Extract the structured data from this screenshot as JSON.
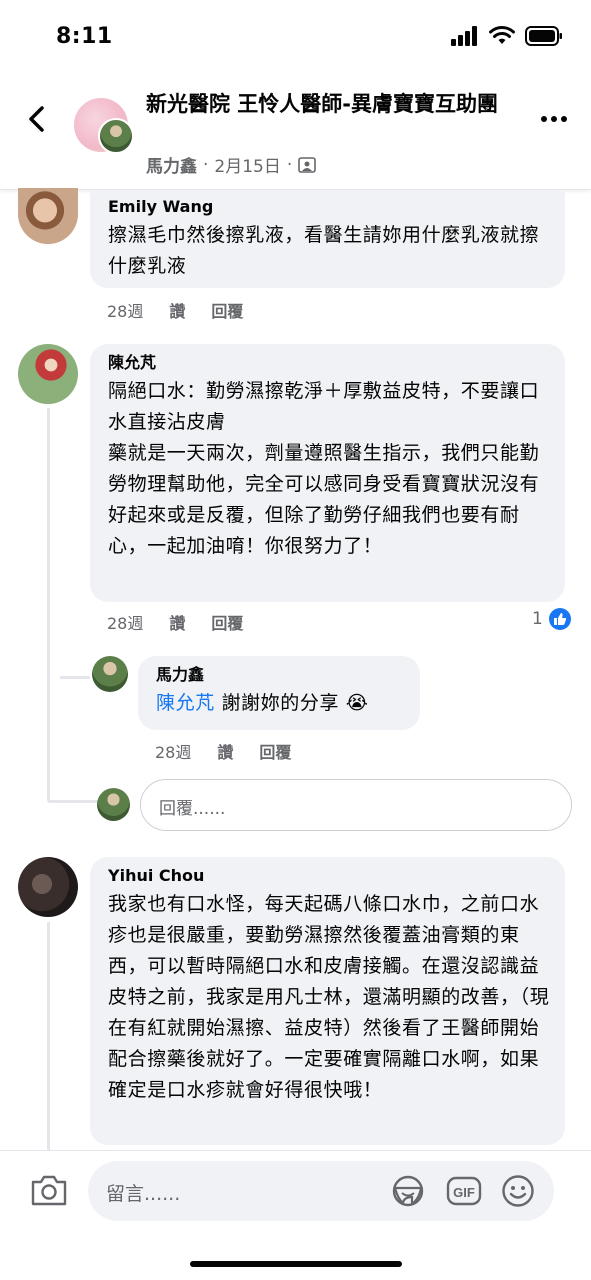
{
  "status_bar": {
    "time": "8:11"
  },
  "header": {
    "group_title": "新光醫院 王怜人醫師-異膚寶寶互助團",
    "author": "馬力鑫",
    "date": "2月15日",
    "separator": "·"
  },
  "comments": [
    {
      "name": "Emily Wang",
      "text": "擦濕毛巾然後擦乳液，看醫生請妳用什麼乳液就擦什麼乳液",
      "age": "28週",
      "like": "讚",
      "reply": "回覆"
    },
    {
      "name": "陳允芃",
      "text_1": "隔絕口水：勤勞濕擦乾淨＋厚敷益皮特，不要讓口水直接沾皮膚",
      "text_2": "藥就是一天兩次，劑量遵照醫生指示，我們只能勤勞物理幫助他，完全可以感同身受看寶寶狀況沒有好起來或是反覆，但除了勤勞仔細我們也要有耐心，一起加油唷！你很努力了！",
      "age": "28週",
      "like": "讚",
      "reply": "回覆",
      "reaction_count": "1"
    },
    {
      "name": "馬力鑫",
      "mention": "陳允芃",
      "text": "謝謝妳的分享",
      "emoji": "😭",
      "age": "28週",
      "like": "讚",
      "reply": "回覆"
    },
    {
      "name": "Yihui Chou",
      "text": "我家也有口水怪，每天起碼八條口水巾，之前口水疹也是很嚴重，要勤勞濕擦然後覆蓋油膏類的東西，可以暫時隔絕口水和皮膚接觸。在還沒認識益皮特之前，我家是用凡士林，還滿明顯的改善，（現在有紅就開始濕擦、益皮特）然後看了王醫師開始配合擦藥後就好了。一定要確實隔離口水啊，如果確定是口水疹就會好得很快哦！"
    }
  ],
  "reply_input": {
    "placeholder": "回覆......"
  },
  "comment_bar": {
    "placeholder": "留言......",
    "icons": [
      "camera-icon",
      "sticker-icon",
      "gif-icon",
      "emoji-icon"
    ]
  },
  "colors": {
    "bubble": "#f0f2f5",
    "link": "#1877f2",
    "muted": "#65676b"
  }
}
